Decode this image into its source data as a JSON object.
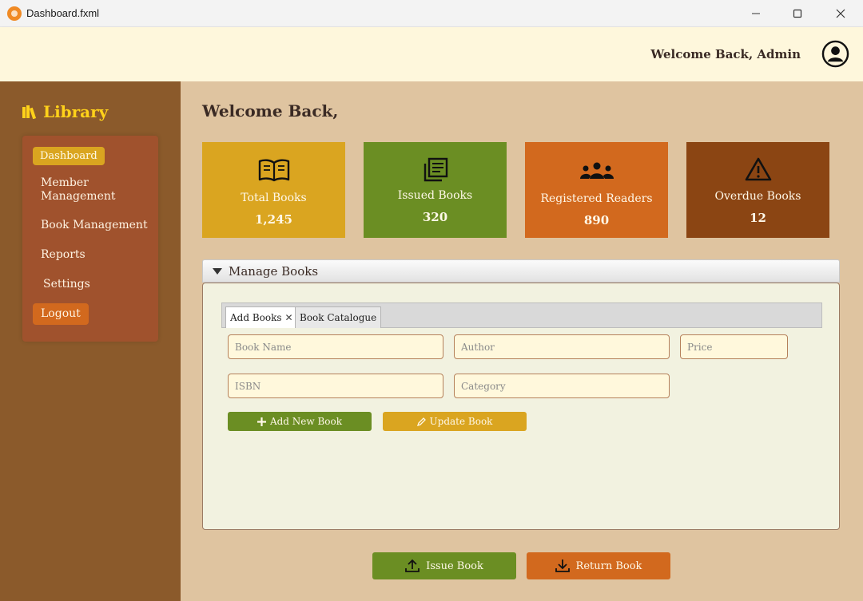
{
  "window": {
    "title": "Dashboard.fxml",
    "icons": [
      "app-icon",
      "minimize-icon",
      "maximize-icon",
      "close-icon"
    ]
  },
  "header": {
    "welcome": "Welcome Back, Admin",
    "avatar_icon": "user-circle-icon"
  },
  "sidebar": {
    "brand_icon": "books-icon",
    "brand_label": "Library",
    "items": [
      {
        "label": "Dashboard",
        "active": true
      },
      {
        "label": "Member Management"
      },
      {
        "label": "Book Management"
      },
      {
        "label": "Reports"
      },
      {
        "label": "Settings"
      },
      {
        "label": "Logout"
      }
    ]
  },
  "main": {
    "title": "Welcome Back,",
    "cards": [
      {
        "label": "Total Books",
        "value": "1,245",
        "icon": "open-book-icon",
        "color": "#daa520"
      },
      {
        "label": "Issued Books",
        "value": "320",
        "icon": "document-stack-icon",
        "color": "#6b8e23"
      },
      {
        "label": "Registered Readers",
        "value": "890",
        "icon": "users-group-icon",
        "color": "#d2691e"
      },
      {
        "label": "Overdue Books",
        "value": "12",
        "icon": "warning-icon",
        "color": "#8b4513"
      }
    ],
    "manage_pane": {
      "title": "Manage Books",
      "tabs": [
        {
          "label": "Add Books",
          "selected": true,
          "closable": true
        },
        {
          "label": "Book Catalogue"
        }
      ],
      "fields": {
        "book_name": "Book Name",
        "author": "Author",
        "price": "Price",
        "isbn": "ISBN",
        "category": "Category"
      },
      "add_button": "Add New Book",
      "update_button": "Update Book"
    },
    "issue_button": "Issue Book",
    "return_button": "Return Book"
  },
  "colors": {
    "sidebar_bg": "#8b5a2b",
    "nav_panel_bg": "#a0522d",
    "main_bg": "#dfc4a0",
    "header_bg": "#fef7dc",
    "accent_gold": "#daa520",
    "accent_green": "#6b8e23",
    "accent_orange": "#d2691e",
    "accent_brown": "#8b4513"
  }
}
